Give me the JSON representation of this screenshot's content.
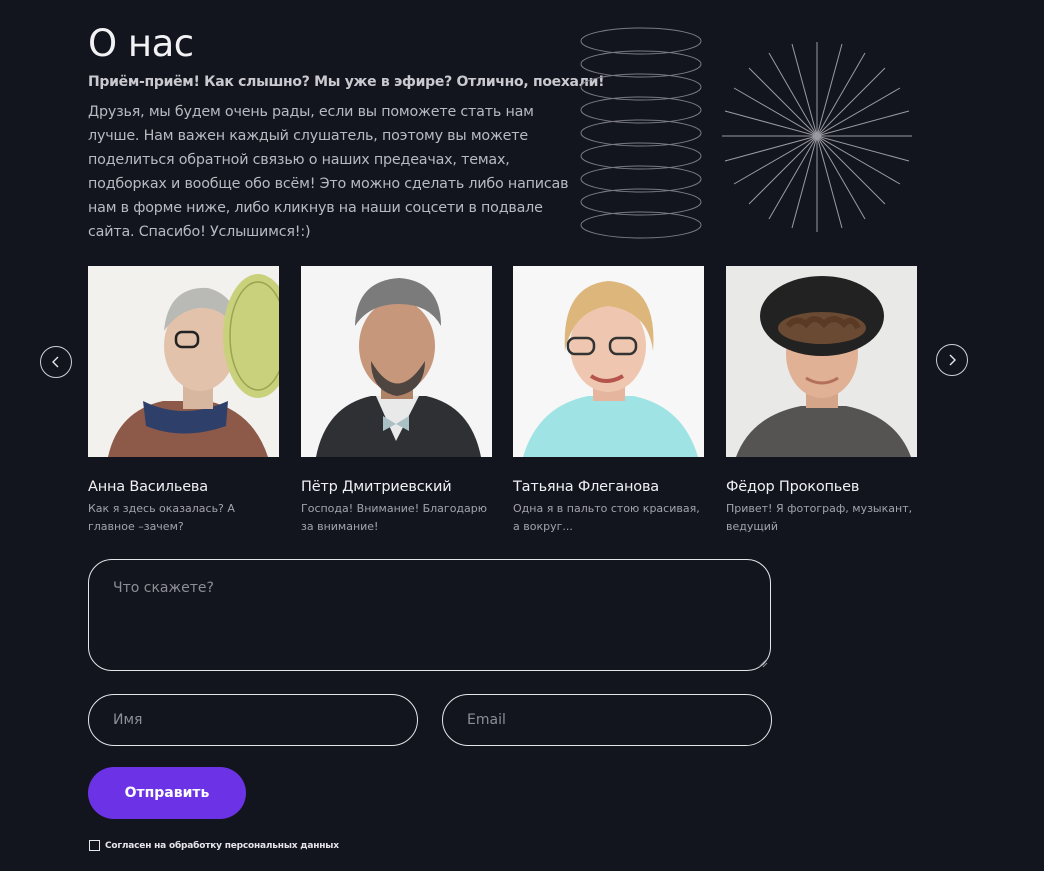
{
  "about": {
    "title": "О нас",
    "lead": "Приём-приём! Как слышно? Мы уже в эфире? Отлично, поехали!",
    "description": "Друзья, мы будем очень рады, если вы поможете стать нам лучше. Нам важен каждый слушатель, поэтому вы можете поделиться обратной связью о наших предеачах, темах, подборках и вообще обо всём! Это можно сделать либо написав нам в форме ниже, либо кликнув на наши соцсети в подвале сайта. Спасибо! Услышимся!:)"
  },
  "carousel": {
    "prev_icon": "chevron-left-icon",
    "next_icon": "chevron-right-icon",
    "hosts": [
      {
        "name": "Анна Васильева",
        "quote": "Как я здесь оказалась? А главное –зачем?"
      },
      {
        "name": "Пётр Дмитриевский",
        "quote": "Господа! Внимание! Благодарю за внимание!"
      },
      {
        "name": "Татьяна Флеганова",
        "quote": "Одна я в пальто стою красивая, а вокруг..."
      },
      {
        "name": "Фёдор Прокопьев",
        "quote": "Привет! Я фотограф, музыкант, ведущий"
      }
    ]
  },
  "form": {
    "message_placeholder": "Что скажете?",
    "name_placeholder": "Имя",
    "email_placeholder": "Email",
    "submit_label": "Отправить",
    "consent_label": "Согласен на обработку персональных данных",
    "consent_checked": false
  },
  "colors": {
    "background": "#13151e",
    "accent": "#6c33e6"
  }
}
